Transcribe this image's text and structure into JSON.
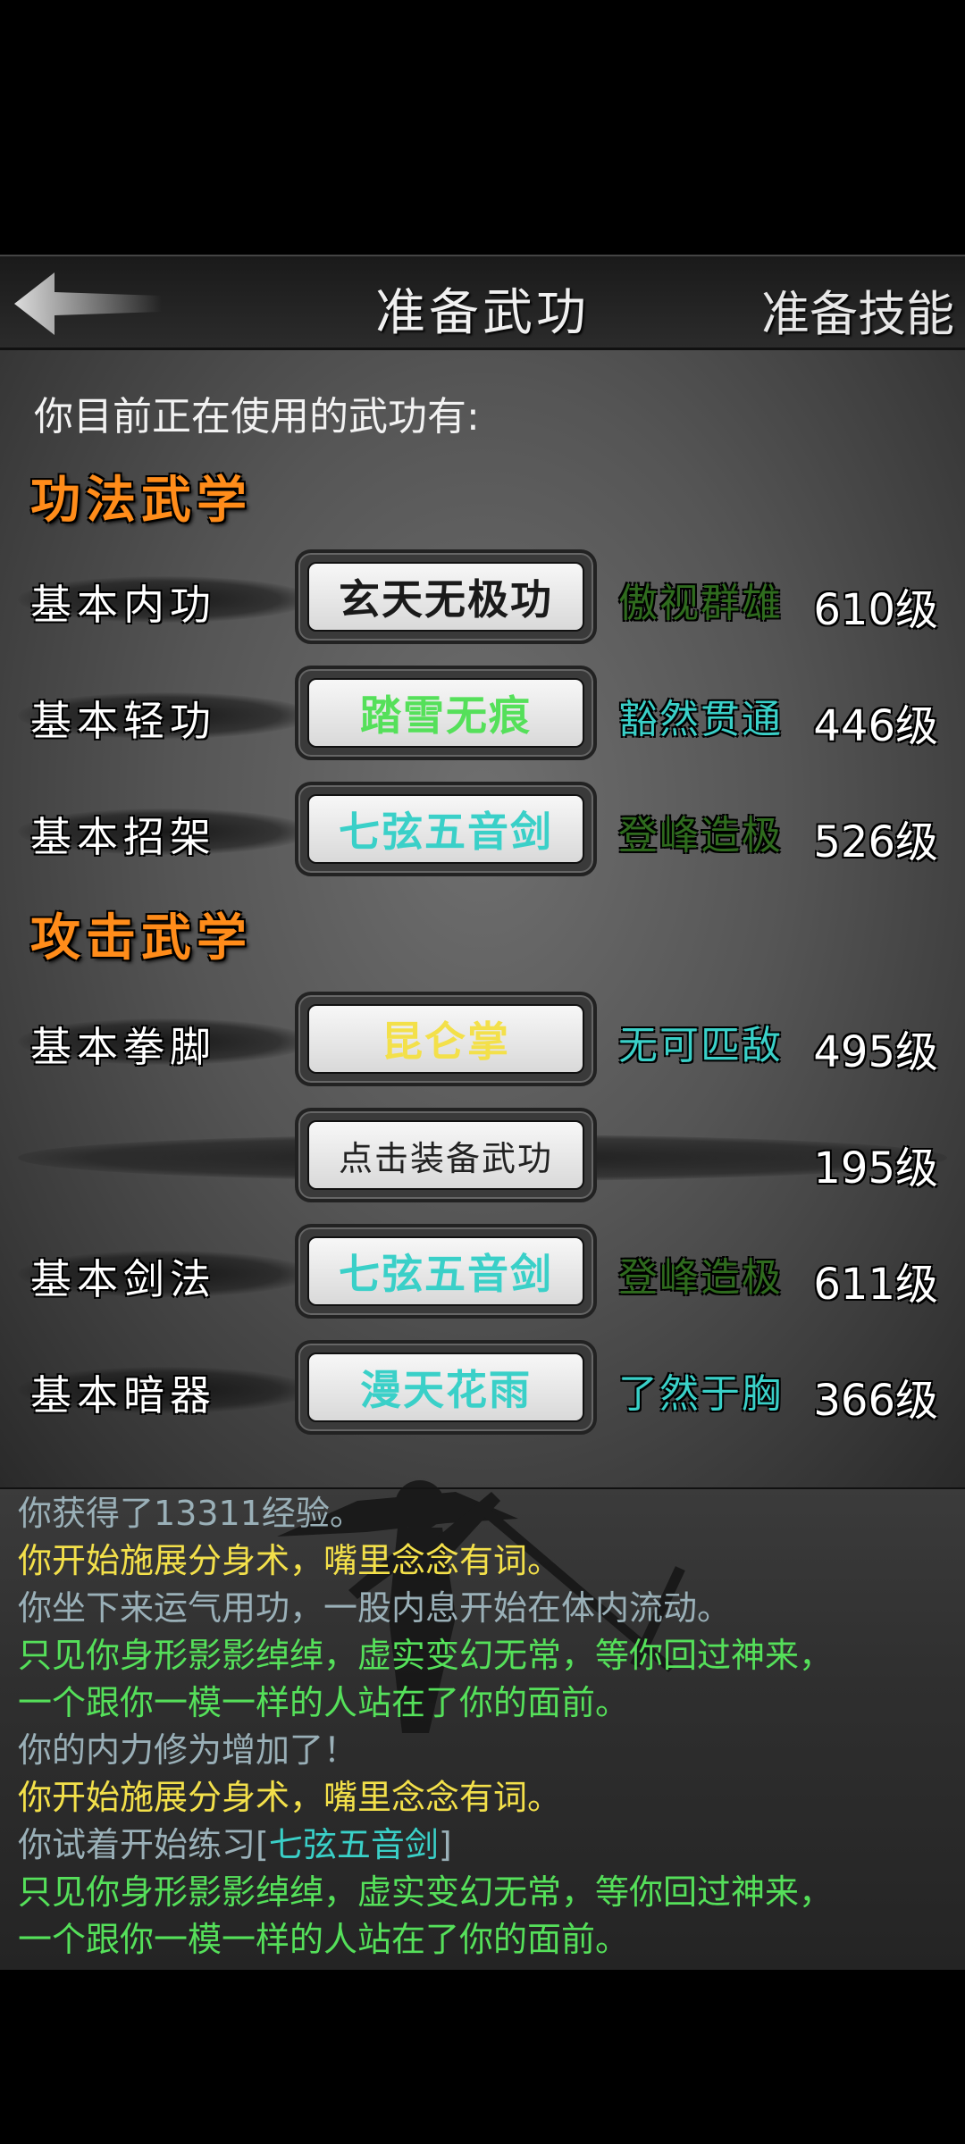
{
  "header": {
    "title": "准备武功",
    "right_button": "准备技能"
  },
  "using_label": "你目前正在使用的武功有:",
  "sections": [
    {
      "title": "功法武学",
      "rows": [
        {
          "label": "基本内功",
          "skill": "玄天无极功",
          "skill_color": "#1a1a1a",
          "rank": "傲视群雄",
          "rank_color": "#2f6b1e",
          "level": "610级"
        },
        {
          "label": "基本轻功",
          "skill": "踏雪无痕",
          "skill_color": "#55e05a",
          "rank": "豁然贯通",
          "rank_color": "#3ad0c8",
          "level": "446级"
        },
        {
          "label": "基本招架",
          "skill": "七弦五音剑",
          "skill_color": "#3ad0c8",
          "rank": "登峰造极",
          "rank_color": "#2f6b1e",
          "level": "526级"
        }
      ]
    },
    {
      "title": "攻击武学",
      "rows": [
        {
          "label": "基本拳脚",
          "skill": "昆仑掌",
          "skill_color": "#f3e04a",
          "rank": "无可匹敌",
          "rank_color": "#3ad0c8",
          "level": "495级"
        },
        {
          "label": "",
          "skill": "点击装备武功",
          "skill_color": "#222222",
          "rank": "",
          "rank_color": "#ffffff",
          "level": "195级"
        },
        {
          "label": "基本剑法",
          "skill": "七弦五音剑",
          "skill_color": "#3ad0c8",
          "rank": "登峰造极",
          "rank_color": "#2f6b1e",
          "level": "611级"
        },
        {
          "label": "基本暗器",
          "skill": "漫天花雨",
          "skill_color": "#3ad0c8",
          "rank": "了然于胸",
          "rank_color": "#3ad0c8",
          "level": "366级"
        }
      ]
    }
  ],
  "log": [
    {
      "text": "你获得了13311经验。",
      "color": "#9ab0b8"
    },
    {
      "text": "你开始施展分身术，嘴里念念有词。",
      "color": "#f3e04a"
    },
    {
      "text": "你坐下来运气用功，一股内息开始在体内流动。",
      "color": "#9ab0b8"
    },
    {
      "text": "只见你身形影影绰绰，虚实变幻无常，等你回过神来，",
      "color": "#55e05a"
    },
    {
      "text": "一个跟你一模一样的人站在了你的面前。",
      "color": "#55e05a"
    },
    {
      "text": "你的内力修为增加了！",
      "color": "#9ab0b8"
    },
    {
      "text": "你开始施展分身术，嘴里念念有词。",
      "color": "#f3e04a"
    },
    {
      "text": "你试着开始练习[七弦五音剑]",
      "color": "#9ab0b8",
      "highlight": "七弦五音剑",
      "highlight_color": "#3ad0c8"
    },
    {
      "text": "只见你身形影影绰绰，虚实变幻无常，等你回过神来，",
      "color": "#55e05a"
    },
    {
      "text": "一个跟你一模一样的人站在了你的面前。",
      "color": "#55e05a"
    }
  ],
  "icons": {
    "back": "back-arrow-icon"
  }
}
